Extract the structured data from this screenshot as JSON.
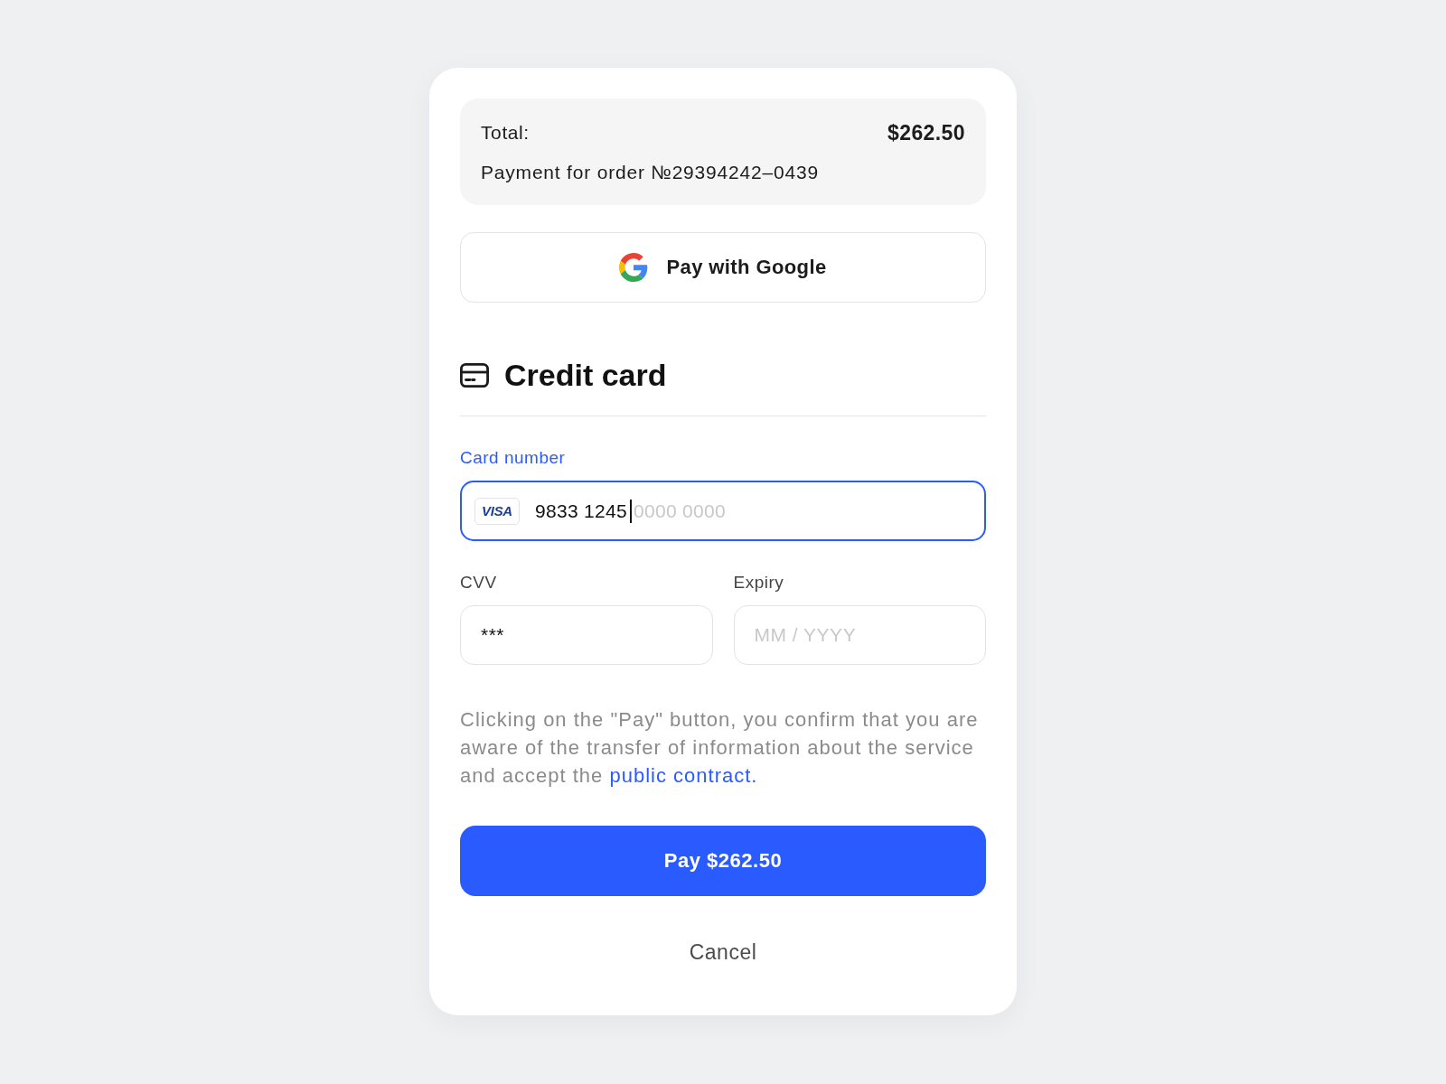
{
  "summary": {
    "total_label": "Total:",
    "total_amount": "$262.50",
    "description": "Payment for order №29394242–0439"
  },
  "google_pay_button": {
    "label": "Pay with Google"
  },
  "section": {
    "title": "Credit card"
  },
  "card_number": {
    "label": "Card number",
    "focused": true,
    "brand": "VISA",
    "value": "9833 1245",
    "placeholder": "0000 0000"
  },
  "cvv": {
    "label": "CVV",
    "focused": false,
    "value": "***"
  },
  "expiry": {
    "label": "Expiry",
    "focused": false,
    "placeholder": "MM / YYYY"
  },
  "consent": {
    "text": "Clicking on the \"Pay\" button, you confirm that you are aware of the transfer of information about the service and accept the",
    "link": "public contract."
  },
  "pay_button": {
    "label": "Pay $262.50"
  },
  "cancel_button": {
    "label": "Cancel"
  }
}
